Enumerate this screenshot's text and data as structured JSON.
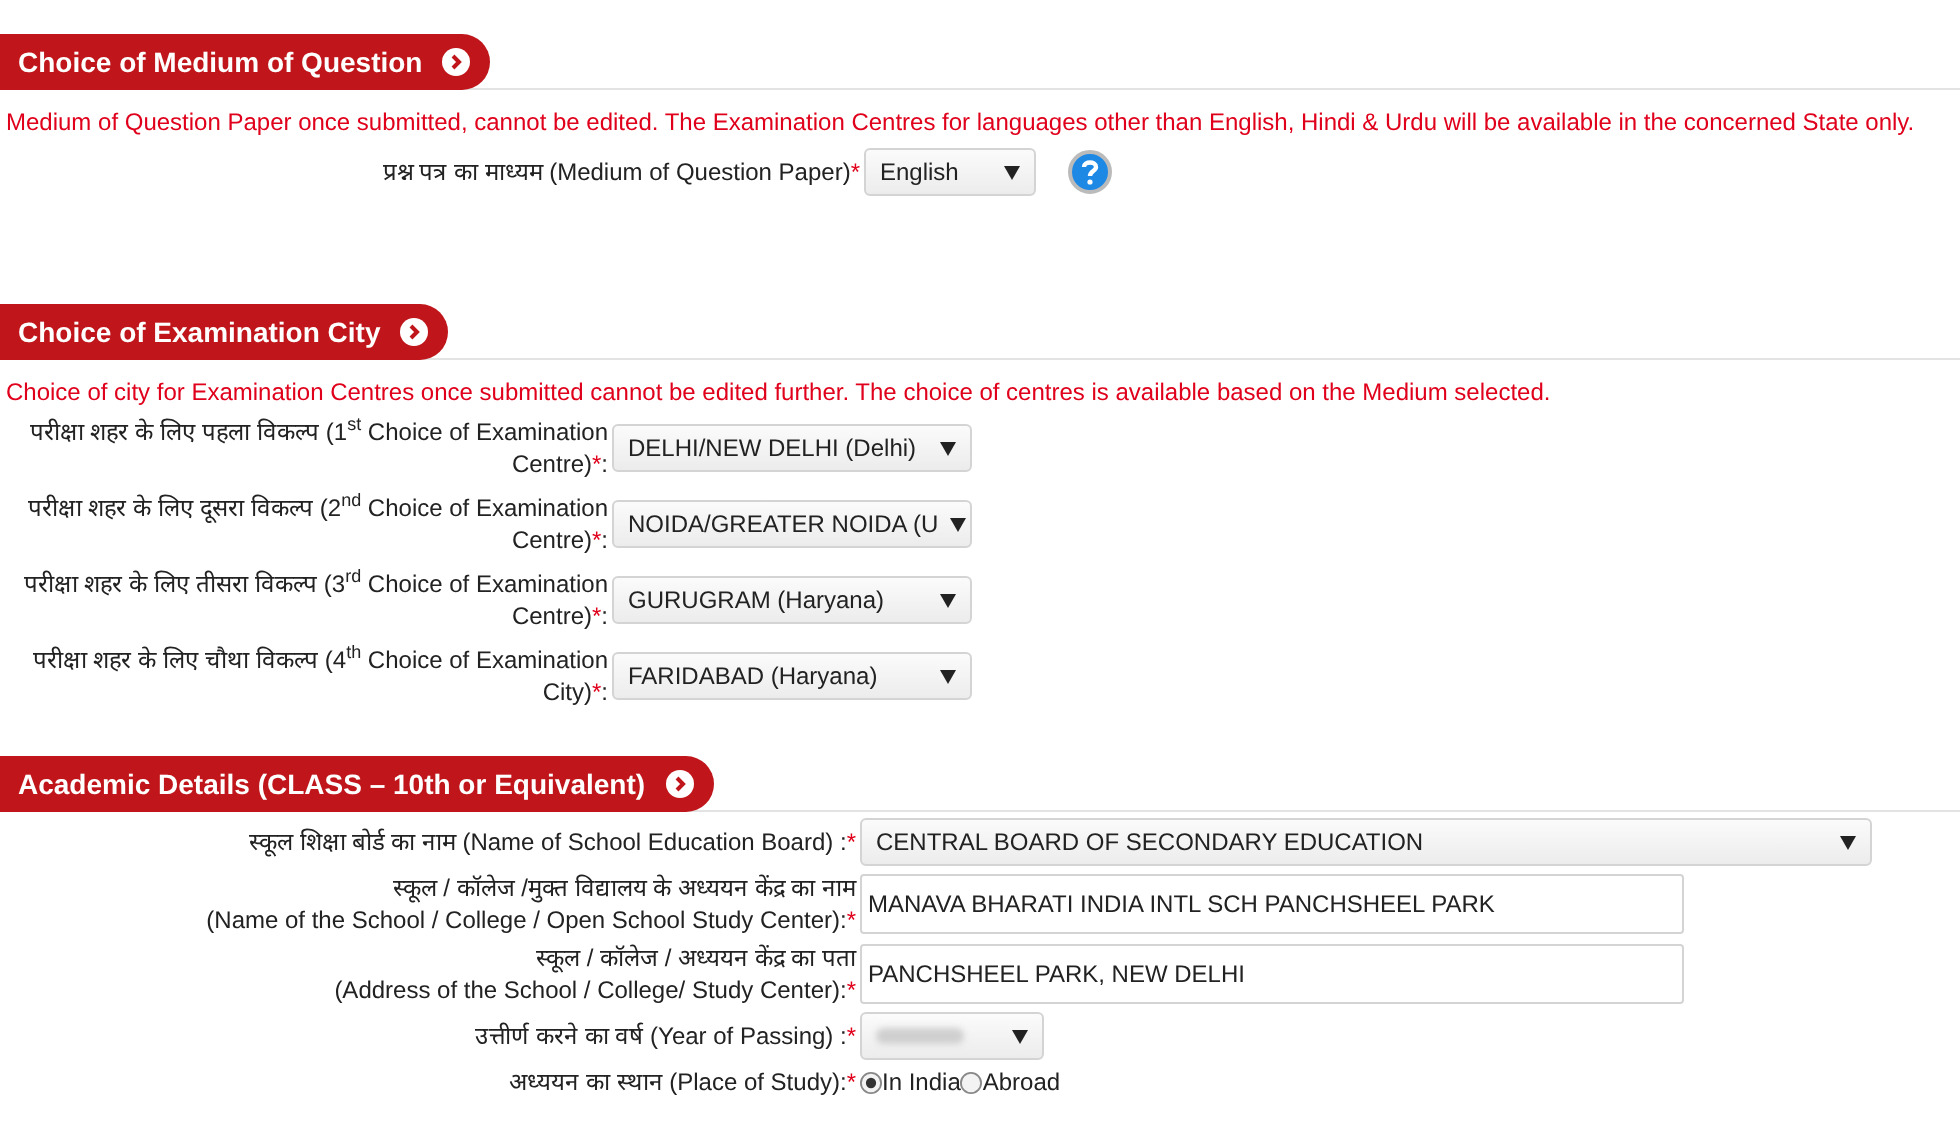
{
  "sections": [
    {
      "kind": "medium",
      "title": "Choice of Medium of Question",
      "note": "Medium of Question Paper once submitted, cannot be edited. The Examination Centres for languages other than English, Hindi & Urdu will be available in the concerned State only.",
      "fields": [
        {
          "kind": "select",
          "label": "प्रश्न पत्र का माध्यम (Medium of Question Paper)",
          "required_mark": "*",
          "value": "English",
          "help": true
        }
      ]
    },
    {
      "kind": "city",
      "title": "Choice of Examination City",
      "note": "Choice of city for Examination Centres once submitted cannot be edited further. The choice of centres is available based on the Medium selected.",
      "fields": [
        {
          "kind": "select",
          "label": "परीक्षा शहर के लिए पहला विकल्प (1$^{st}$ Choice of Examination Centre)",
          "required_mark": "*",
          "suffix": ":",
          "value": "DELHI/NEW DELHI (Delhi)"
        },
        {
          "kind": "select",
          "label": "परीक्षा शहर के लिए दूसरा विकल्प (2$^{nd}$ Choice of Examination Centre)",
          "required_mark": "*",
          "suffix": ":",
          "value": "NOIDA/GREATER NOIDA (U"
        },
        {
          "kind": "select",
          "label": "परीक्षा शहर के लिए तीसरा विकल्प (3$^{rd}$ Choice of Examination Centre)",
          "required_mark": "*",
          "suffix": ":",
          "value": "GURUGRAM (Haryana)"
        },
        {
          "kind": "select",
          "label": "परीक्षा शहर के लिए चौथा विकल्प (4$^{th}$ Choice of Examination City)",
          "required_mark": "*",
          "suffix": ":",
          "value": "FARIDABAD (Haryana)"
        }
      ]
    },
    {
      "kind": "academic",
      "title": "Academic Details (CLASS – 10th or Equivalent)",
      "fields": [
        {
          "kind": "wide_select",
          "label": "स्कूल शिक्षा बोर्ड का नाम (Name of School Education Board) :",
          "required_mark": "*",
          "value": "CENTRAL BOARD OF SECONDARY EDUCATION"
        },
        {
          "kind": "text",
          "label_lines": [
            "स्कूल / कॉलेज /मुक्त विद्यालय के अध्ययन केंद्र का नाम",
            "(Name of the School / College / Open School Study Center):"
          ],
          "required_mark": "*",
          "value": "MANAVA BHARATI INDIA INTL SCH PANCHSHEEL PARK"
        },
        {
          "kind": "text",
          "label_lines": [
            "स्कूल / कॉलेज / अध्ययन केंद्र का पता",
            "(Address of the School / College/ Study Center):"
          ],
          "required_mark": "*",
          "value": "PANCHSHEEL PARK, NEW DELHI"
        },
        {
          "kind": "blurred_select",
          "label": "उत्तीर्ण करने का वर्ष (Year of Passing) :",
          "required_mark": "*"
        },
        {
          "kind": "radio",
          "label": "अध्ययन का स्थान (Place of Study):",
          "required_mark": "*",
          "options": [
            {
              "label": "In India",
              "selected": true
            },
            {
              "label": "Abroad",
              "selected": false
            }
          ]
        }
      ]
    }
  ]
}
